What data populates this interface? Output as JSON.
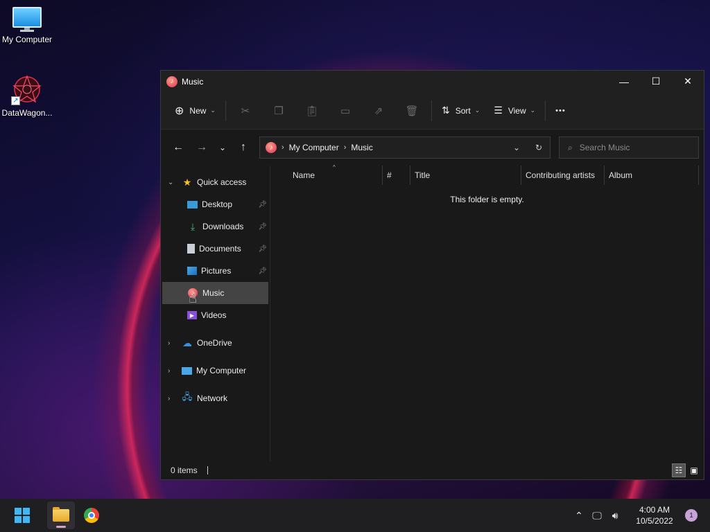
{
  "desktop": {
    "icons": [
      {
        "label": "My Computer",
        "icon": "monitor-icon"
      },
      {
        "label": "DataWagon...",
        "icon": "datawagon-logo-icon"
      }
    ]
  },
  "window": {
    "title": "Music",
    "controls": {
      "minimize": "—",
      "maximize": "☐",
      "close": "✕"
    }
  },
  "toolbar": {
    "new_label": "New",
    "sort_label": "Sort",
    "view_label": "View",
    "more_label": "•••"
  },
  "address": {
    "breadcrumbs": [
      "My Computer",
      "Music"
    ],
    "search_placeholder": "Search Music"
  },
  "nav": {
    "quick_access": "Quick access",
    "pinned": [
      {
        "label": "Desktop",
        "icon": "desktop-icon"
      },
      {
        "label": "Downloads",
        "icon": "download-icon"
      },
      {
        "label": "Documents",
        "icon": "document-icon"
      },
      {
        "label": "Pictures",
        "icon": "pictures-icon"
      }
    ],
    "unpinned": [
      {
        "label": "Music",
        "icon": "music-icon",
        "selected": true
      },
      {
        "label": "Videos",
        "icon": "videos-icon"
      }
    ],
    "roots": [
      {
        "label": "OneDrive",
        "icon": "cloud-icon"
      },
      {
        "label": "My Computer",
        "icon": "computer-icon"
      },
      {
        "label": "Network",
        "icon": "network-icon"
      }
    ]
  },
  "columns": [
    "Name",
    "#",
    "Title",
    "Contributing artists",
    "Album"
  ],
  "empty_message": "This folder is empty.",
  "status": {
    "count": "0 items"
  },
  "taskbar": {
    "time": "4:00 AM",
    "date": "10/5/2022",
    "notification_count": "1"
  },
  "colors": {
    "accent": "#3fb6f5",
    "selection": "#444444",
    "window_bg": "#191919"
  }
}
